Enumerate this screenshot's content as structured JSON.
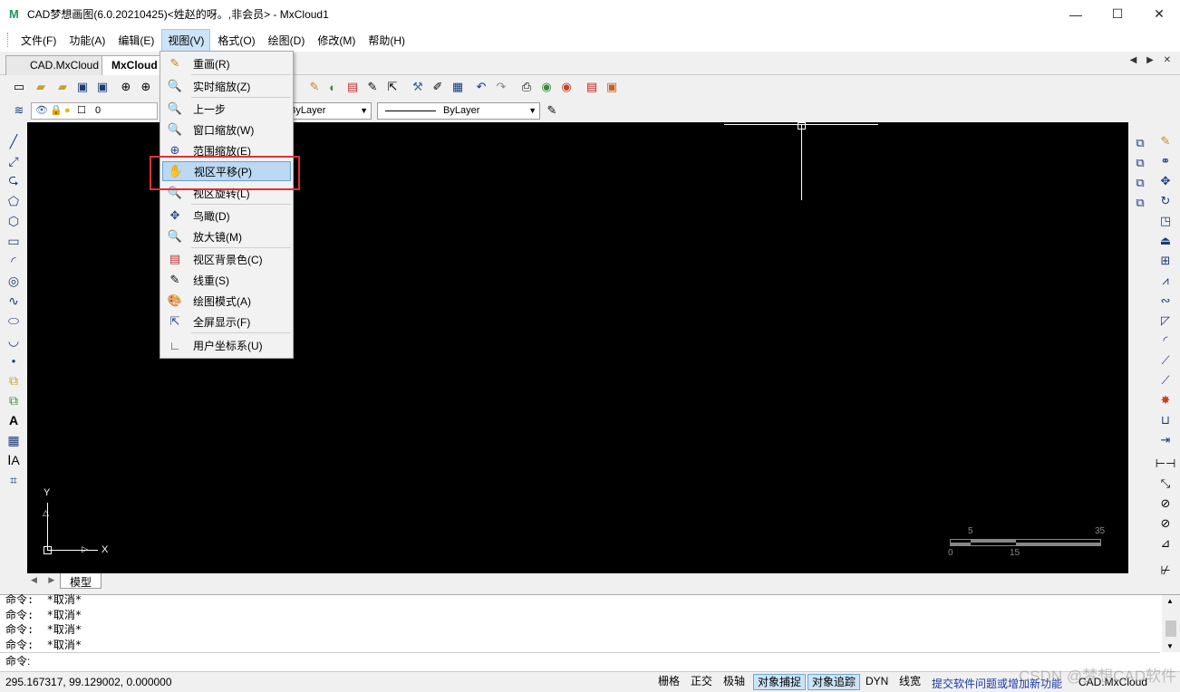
{
  "window": {
    "logo": "M",
    "title": "CAD梦想画图(6.0.20210425)<姓赵的呀。,非会员> - MxCloud1",
    "minimize": "—",
    "maximize": "☐",
    "close": "✕"
  },
  "menubar": {
    "items": [
      "文件(F)",
      "功能(A)",
      "编辑(E)",
      "视图(V)",
      "格式(O)",
      "绘图(D)",
      "修改(M)",
      "帮助(H)"
    ],
    "active_index": 3
  },
  "tabs": {
    "items": [
      "CAD.MxCloud",
      "MxCloud"
    ],
    "nav": "◀ ▶ ✕"
  },
  "toolbar2": {
    "layer_value": "0",
    "linetype_value": "ByLayer",
    "lineweight_value": "ByLayer"
  },
  "view_menu": {
    "items": [
      {
        "label": "重画(R)",
        "icon": "✎"
      },
      {
        "label": "实时缩放(Z)",
        "icon": "🔍"
      },
      {
        "label": "上一步",
        "icon": "🔍"
      },
      {
        "label": "窗口缩放(W)",
        "icon": "🔍"
      },
      {
        "label": "范围缩放(E)",
        "icon": "⊕"
      },
      {
        "label": "视区平移(P)",
        "icon": "✋"
      },
      {
        "label": "视区旋转(L)",
        "icon": "🔍"
      },
      {
        "label": "鸟瞰(D)",
        "icon": "✥"
      },
      {
        "label": "放大镜(M)",
        "icon": "🔍"
      },
      {
        "label": "视区背景色(C)",
        "icon": "▤"
      },
      {
        "label": "线重(S)",
        "icon": "✎"
      },
      {
        "label": "绘图模式(A)",
        "icon": "🎨"
      },
      {
        "label": "全屏显示(F)",
        "icon": "⇱"
      },
      {
        "label": "用户坐标系(U)",
        "icon": "∟"
      }
    ],
    "highlighted_index": 5
  },
  "canvas": {
    "background": "#000000",
    "ucs": {
      "y_label": "Y",
      "x_label": "X"
    },
    "scale": {
      "top_labels": [
        "5",
        "35"
      ],
      "bottom_labels": [
        "0",
        "15"
      ]
    }
  },
  "model_tab": {
    "nav": "◀ ▶",
    "label": "模型"
  },
  "command": {
    "history": [
      "命令:  *取消*",
      "命令:  *取消*",
      "命令:  *取消*",
      "命令:  *取消*"
    ],
    "prompt": "命令:"
  },
  "status": {
    "coords": "295.167317,  99.129002,  0.000000",
    "toggles": [
      {
        "label": "栅格",
        "on": false
      },
      {
        "label": "正交",
        "on": false
      },
      {
        "label": "极轴",
        "on": false
      },
      {
        "label": "对象捕捉",
        "on": true
      },
      {
        "label": "对象追踪",
        "on": true
      },
      {
        "label": "DYN",
        "on": false
      },
      {
        "label": "线宽",
        "on": false
      }
    ],
    "link": "提交软件问题或增加新功能",
    "app": "CAD.MxCloud"
  },
  "watermark": "CSDN @梦想CAD软件",
  "colors": {
    "highlight": "#bcd8f2",
    "red_frame": "#e03030",
    "canvas": "#000000",
    "link": "#1a3aa8"
  }
}
